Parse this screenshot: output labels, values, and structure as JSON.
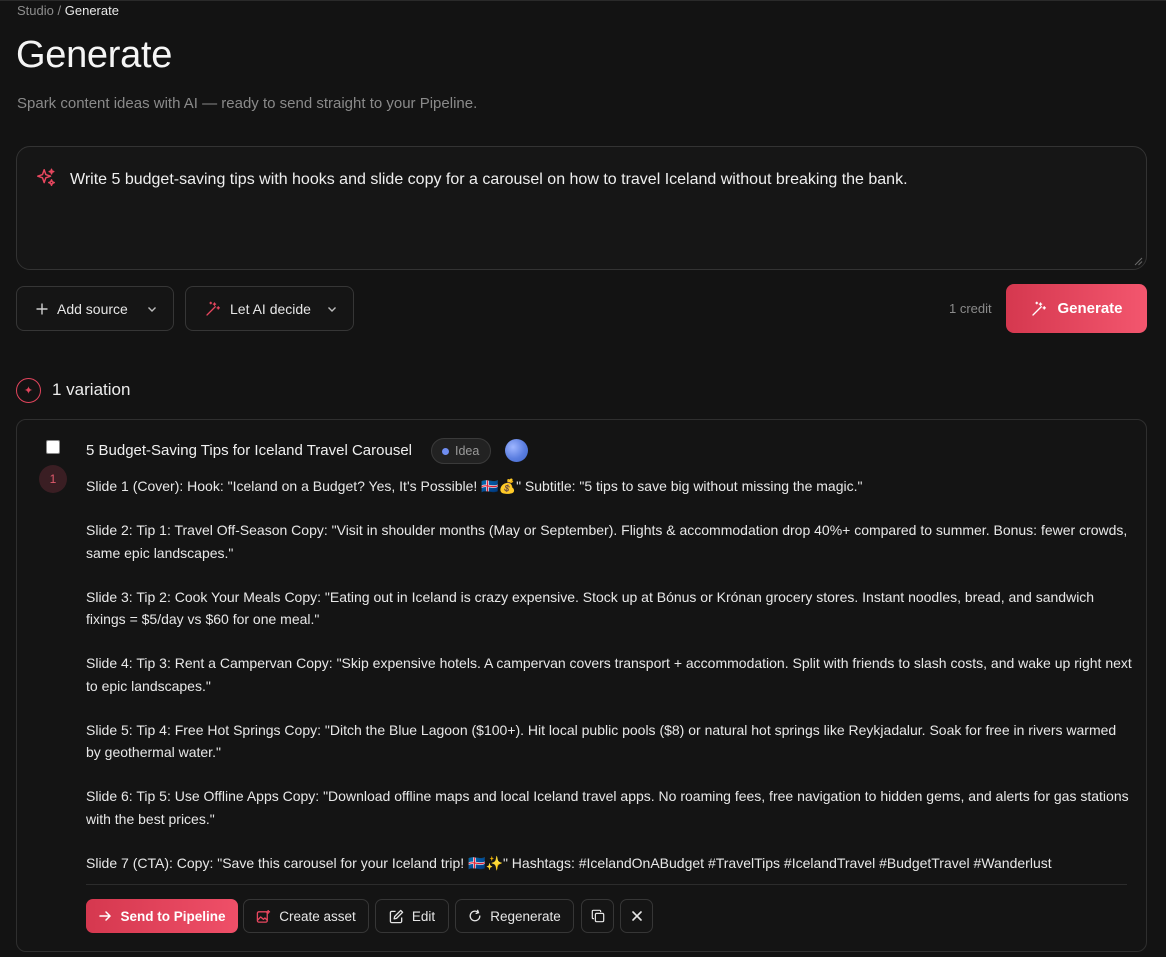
{
  "breadcrumb": {
    "parent": "Studio",
    "separator": "/",
    "current": "Generate"
  },
  "page": {
    "title": "Generate",
    "subtitle": "Spark content ideas with AI — ready to send straight to your Pipeline."
  },
  "prompt": {
    "value": "Write 5 budget-saving tips with hooks and slide copy for a carousel on how to travel Iceland without breaking the bank."
  },
  "controls": {
    "add_source_label": "Add source",
    "ai_decide_label": "Let AI decide",
    "credit_label": "1 credit",
    "generate_label": "Generate"
  },
  "results": {
    "count_label": "1 variation",
    "variations": [
      {
        "number": "1",
        "title": "5 Budget-Saving Tips for Iceland Travel Carousel",
        "badge": "Idea",
        "slides": [
          "Slide 1 (Cover): Hook: \"Iceland on a Budget? Yes, It's Possible! 🇮🇸💰\" Subtitle: \"5 tips to save big without missing the magic.\"",
          "Slide 2: Tip 1: Travel Off-Season Copy: \"Visit in shoulder months (May or September). Flights & accommodation drop 40%+ compared to summer. Bonus: fewer crowds, same epic landscapes.\"",
          "Slide 3: Tip 2: Cook Your Meals Copy: \"Eating out in Iceland is crazy expensive. Stock up at Bónus or Krónan grocery stores. Instant noodles, bread, and sandwich fixings = $5/day vs $60 for one meal.\"",
          "Slide 4: Tip 3: Rent a Campervan Copy: \"Skip expensive hotels. A campervan covers transport + accommodation. Split with friends to slash costs, and wake up right next to epic landscapes.\"",
          "Slide 5: Tip 4: Free Hot Springs Copy: \"Ditch the Blue Lagoon ($100+). Hit local public pools ($8) or natural hot springs like Reykjadalur. Soak for free in rivers warmed by geothermal water.\"",
          "Slide 6: Tip 5: Use Offline Apps Copy: \"Download offline maps and local Iceland travel apps. No roaming fees, free navigation to hidden gems, and alerts for gas stations with the best prices.\"",
          "Slide 7 (CTA): Copy: \"Save this carousel for your Iceland trip! 🇮🇸✨\" Hashtags: #IcelandOnABudget #TravelTips #IcelandTravel #BudgetTravel #Wanderlust"
        ],
        "actions": {
          "send_label": "Send to Pipeline",
          "create_label": "Create asset",
          "edit_label": "Edit",
          "regenerate_label": "Regenerate"
        }
      }
    ]
  },
  "colors": {
    "accent": "#e8475f",
    "background": "#131313",
    "badge_dot": "#6f8df0"
  }
}
